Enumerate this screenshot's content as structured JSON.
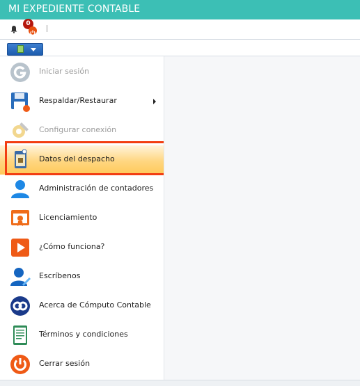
{
  "window": {
    "title": "MI EXPEDIENTE CONTABLE"
  },
  "toolbar": {
    "notification_count": "0"
  },
  "menu": {
    "items": [
      {
        "label": "Iniciar sesión",
        "icon": "login-icon",
        "enabled": false
      },
      {
        "label": "Respaldar/Restaurar",
        "icon": "backup-restore-icon",
        "enabled": true,
        "has_submenu": true
      },
      {
        "label": "Configurar conexión",
        "icon": "settings-connection-icon",
        "enabled": false
      },
      {
        "label": "Datos del despacho",
        "icon": "office-data-icon",
        "enabled": true,
        "selected": true
      },
      {
        "label": "Administración de contadores",
        "icon": "user-admin-icon",
        "enabled": true
      },
      {
        "label": "Licenciamiento",
        "icon": "license-certificate-icon",
        "enabled": true
      },
      {
        "label": "¿Cómo funciona?",
        "icon": "play-video-icon",
        "enabled": true
      },
      {
        "label": "Escríbenos",
        "icon": "write-to-us-icon",
        "enabled": true
      },
      {
        "label": "Acerca de Cómputo Contable",
        "icon": "about-app-icon",
        "enabled": true
      },
      {
        "label": "Términos y condiciones",
        "icon": "terms-document-icon",
        "enabled": true
      },
      {
        "label": "Cerrar sesión",
        "icon": "logout-power-icon",
        "enabled": true
      }
    ]
  },
  "colors": {
    "titlebar": "#3cbfb5",
    "selected_item": "#ffd680",
    "highlight_border": "#f23e12",
    "menu_button": "#1d5cae"
  }
}
